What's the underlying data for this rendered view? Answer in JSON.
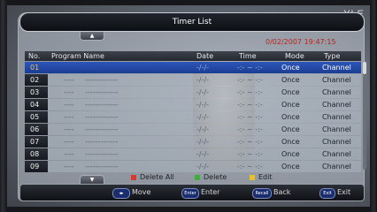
{
  "watermark": "YLE",
  "title": "Timer List",
  "datetime": "0/02/2007 19:47:15",
  "columns": {
    "no": "No.",
    "program": "Program Name",
    "date": "Date",
    "time": "Time",
    "mode": "Mode",
    "type": "Type"
  },
  "rows": [
    {
      "no": "01",
      "program_a": "",
      "program_b": "",
      "date": "-/-/-",
      "time": "-:-  ~  -:-",
      "mode": "Once",
      "type": "Channel"
    },
    {
      "no": "02",
      "program_a": "----",
      "program_b": "-------------",
      "date": "-/-/-",
      "time": "-:-  ~  -:-",
      "mode": "Once",
      "type": "Channel"
    },
    {
      "no": "03",
      "program_a": "----",
      "program_b": "-------------",
      "date": "-/-/-",
      "time": "-:-  ~  -:-",
      "mode": "Once",
      "type": "Channel"
    },
    {
      "no": "04",
      "program_a": "----",
      "program_b": "-------------",
      "date": "-/-/-",
      "time": "-:-  ~  -:-",
      "mode": "Once",
      "type": "Channel"
    },
    {
      "no": "05",
      "program_a": "----",
      "program_b": "-------------",
      "date": "-/-/-",
      "time": "-:-  ~  -:-",
      "mode": "Once",
      "type": "Channel"
    },
    {
      "no": "06",
      "program_a": "----",
      "program_b": "-------------",
      "date": "-/-/-",
      "time": "-:-  ~  -:-",
      "mode": "Once",
      "type": "Channel"
    },
    {
      "no": "07",
      "program_a": "----",
      "program_b": "-------------",
      "date": "-/-/-",
      "time": "-:-  ~  -:-",
      "mode": "Once",
      "type": "Channel"
    },
    {
      "no": "08",
      "program_a": "----",
      "program_b": "-------------",
      "date": "-/-/-",
      "time": "-:-  ~  -:-",
      "mode": "Once",
      "type": "Channel"
    },
    {
      "no": "09",
      "program_a": "----",
      "program_b": "-------------",
      "date": "-/-/-",
      "time": "-:-  ~  -:-",
      "mode": "Once",
      "type": "Channel"
    }
  ],
  "legend": {
    "delete_all": "Delete All",
    "delete": "Delete",
    "edit": "Edit",
    "colors": {
      "red": "#d63a2e",
      "green": "#3fae3a",
      "yellow": "#e6c22a"
    }
  },
  "footer": {
    "move_key": "◂▸",
    "move": "Move",
    "enter_key": "Enter",
    "enter": "Enter",
    "recall_key": "Recall",
    "back": "Back",
    "exit_key": "Exit",
    "exit": "Exit"
  }
}
